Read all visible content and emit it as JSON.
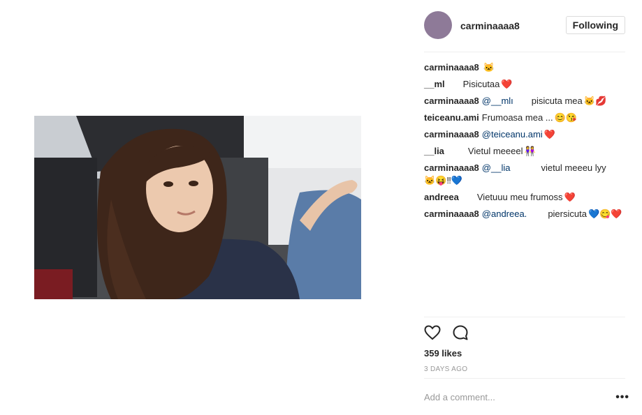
{
  "post": {
    "username": "carminaaaa8",
    "follow_label": "Following",
    "likes": "359 likes",
    "timestamp": "3 DAYS AGO",
    "comment_placeholder": "Add a comment...",
    "more_label": "•••"
  },
  "comments": [
    {
      "user": "carminaaaa8",
      "mention": "",
      "text": "",
      "emoji": "🐱"
    },
    {
      "user": "__ml",
      "mention": "",
      "text": "Pisicutaa",
      "emoji": "❤️"
    },
    {
      "user": "carminaaaa8",
      "mention": "@__mlı",
      "text": "pisicuta mea",
      "emoji": "🐱💋"
    },
    {
      "user": "teiceanu.ami",
      "mention": "",
      "text": "Frumoasa mea ...",
      "emoji": "😊😘"
    },
    {
      "user": "carminaaaa8",
      "mention": "@teiceanu.ami",
      "text": "",
      "emoji": "❤️"
    },
    {
      "user": "__lia",
      "mention": "",
      "text": "Vietul meeeel",
      "emoji": "👭"
    },
    {
      "user": "carminaaaa8",
      "mention": "@__lia",
      "text": "vietul meeeu lyy",
      "emoji": "🐱😝‼💙"
    },
    {
      "user": "andreea",
      "mention": "",
      "text": "Vietuuu meu frumoss",
      "emoji": "❤️"
    },
    {
      "user": "carminaaaa8",
      "mention": "@andreea.",
      "text": "piersicuta",
      "emoji": "💙😋❤️"
    }
  ],
  "icons": {
    "like": "heart-icon",
    "comment": "comment-bubble-icon"
  },
  "colors": {
    "avatar": "#8e7a98",
    "mention": "#003569",
    "muted": "#999999",
    "text": "#262626",
    "border": "#dbdbdb"
  }
}
